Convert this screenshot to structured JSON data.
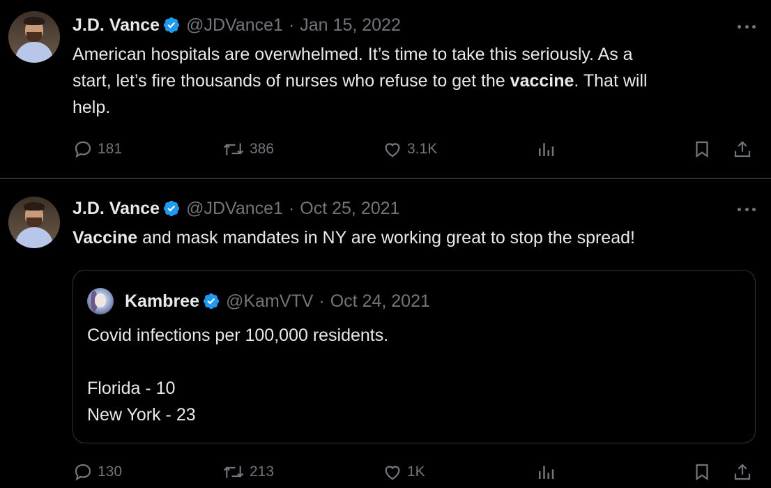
{
  "tweets": [
    {
      "author_name": "J.D. Vance",
      "handle": "@JDVance1",
      "separator": "·",
      "date": "Jan 15, 2022",
      "text_line1": "American hospitals are overwhelmed. It’s time to take this seriously.  As a",
      "text_line2_pre": "start, let’s fire thousands of nurses who refuse to get the ",
      "text_line2_bold": "vaccine",
      "text_line2_post": ". That will",
      "text_line3": "help.",
      "replies": "181",
      "reposts": "386",
      "likes": "3.1K"
    },
    {
      "author_name": "J.D. Vance",
      "handle": "@JDVance1",
      "separator": "·",
      "date": "Oct 25, 2021",
      "text_bold": "Vaccine",
      "text_rest": " and mask mandates in NY are working great to stop the spread!",
      "quote": {
        "author_name": "Kambree",
        "handle": "@KamVTV",
        "separator": "·",
        "date": "Oct 24, 2021",
        "text": "Covid infections per 100,000 residents.\n\nFlorida -  10\nNew York - 23"
      },
      "replies": "130",
      "reposts": "213",
      "likes": "1K"
    }
  ],
  "colors": {
    "background": "#000000",
    "text": "#e7e9ea",
    "secondary": "#71767b",
    "verified": "#1d9bf0",
    "border": "#2f3336"
  },
  "icons": [
    "verified-badge-icon",
    "more-icon",
    "reply-icon",
    "repost-icon",
    "like-icon",
    "views-icon",
    "bookmark-icon",
    "share-icon"
  ]
}
